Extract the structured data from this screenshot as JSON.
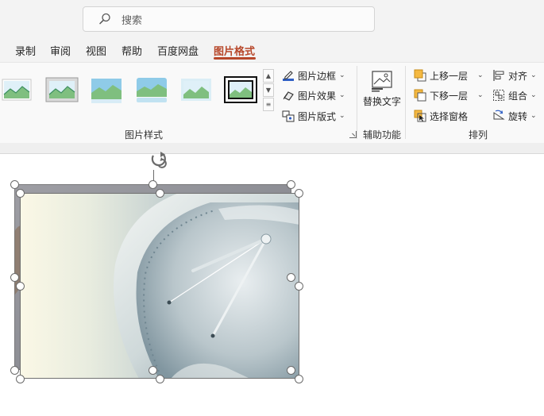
{
  "search": {
    "placeholder": "搜索"
  },
  "tabs": [
    {
      "label": "录制"
    },
    {
      "label": "审阅"
    },
    {
      "label": "视图"
    },
    {
      "label": "帮助"
    },
    {
      "label": "百度网盘"
    },
    {
      "label": "图片格式",
      "active": true
    }
  ],
  "ribbon": {
    "picture_styles": {
      "label": "图片样式",
      "border": "图片边框",
      "effects": "图片效果",
      "layout": "图片版式"
    },
    "accessibility": {
      "label": "辅助功能",
      "alt_text": "替换文字"
    },
    "arrange": {
      "label": "排列",
      "bring_forward": "上移一层",
      "send_backward": "下移一层",
      "selection_pane": "选择窗格",
      "align": "对齐",
      "group": "组合",
      "rotate": "旋转"
    }
  },
  "colors": {
    "accent": "#b7472a",
    "ribbon_bg": "#f9f9f9",
    "titlebar_bg": "#f3f3f3"
  }
}
